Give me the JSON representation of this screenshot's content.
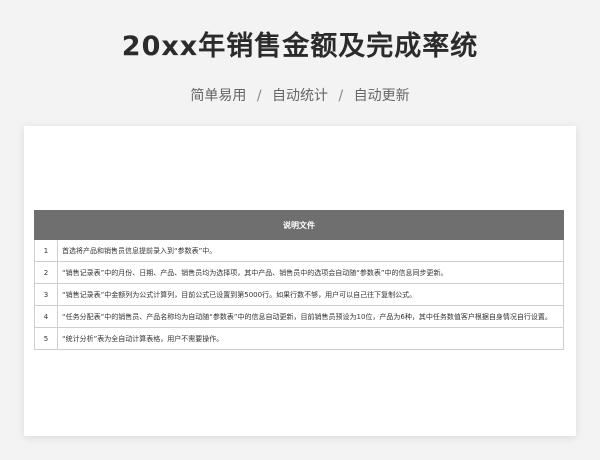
{
  "header": {
    "title": "20xx年销售金额及完成率统",
    "subtitle_parts": [
      "简单易用",
      "自动统计",
      "自动更新"
    ],
    "separator": "/"
  },
  "sheet": {
    "table_header": "说明文件",
    "rows": [
      {
        "num": "1",
        "text": "首选将产品和销售员信息提前录入到“参数表”中。"
      },
      {
        "num": "2",
        "text": "“销售记录表”中的月份、日期、产品、销售员均为选择项，其中产品、销售员中的选项会自动随“参数表”中的信息同步更新。"
      },
      {
        "num": "3",
        "text": "“销售记录表”中金额列为公式计算列，目前公式已设置到第5000行。如果行数不够，用户可以自己往下复制公式。"
      },
      {
        "num": "4",
        "text": "“任务分配表”中的销售员、产品名称均为自动随“参数表”中的信息自动更新，目前销售员预设为10位，产品为6种，其中任务数值客户根据自身情况自行设置。"
      },
      {
        "num": "5",
        "text": "“统计分析”表为全自动计算表格，用户不需要操作。"
      }
    ]
  }
}
